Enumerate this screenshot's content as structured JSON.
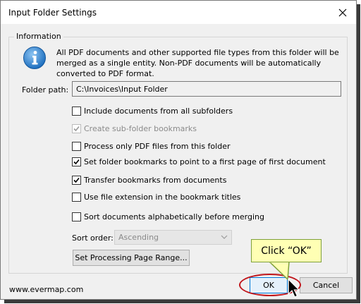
{
  "window": {
    "title": "Input Folder Settings",
    "close_symbol": "✕"
  },
  "group": {
    "label": "Information",
    "info_icon": "info-icon",
    "info_text": "All PDF documents and other supported file types from this folder will be merged as a single entity. Non-PDF documents will be automatically converted to PDF format."
  },
  "folder_path": {
    "label": "Folder path:",
    "value": "C:\\Invoices\\Input Folder"
  },
  "options": [
    {
      "label": "Include documents from all subfolders",
      "checked": false,
      "disabled": false
    },
    {
      "label": "Create sub-folder bookmarks",
      "checked": true,
      "disabled": true
    },
    {
      "label": "Process only PDF files from this folder",
      "checked": false,
      "disabled": false
    },
    {
      "label": "Set folder bookmarks to point to a first page of first document",
      "checked": true,
      "disabled": false
    },
    {
      "label": "Transfer bookmarks from documents",
      "checked": true,
      "disabled": false
    },
    {
      "label": "Use file extension in the bookmark titles",
      "checked": false,
      "disabled": false
    },
    {
      "label": "Sort documents alphabetically before merging",
      "checked": false,
      "disabled": false
    }
  ],
  "sort": {
    "label": "Sort order:",
    "value": "Ascending"
  },
  "buttons": {
    "range": "Set Processing Page Range...",
    "ok": "OK",
    "cancel": "Cancel"
  },
  "footer": {
    "website": "www.evermap.com"
  },
  "annotation": {
    "callout_text": "Click “OK”"
  },
  "colors": {
    "highlight": "#c0161c",
    "callout_bg": "#ffffb4",
    "callout_border": "#7fa13a",
    "info_icon": "#1e6fbf"
  }
}
